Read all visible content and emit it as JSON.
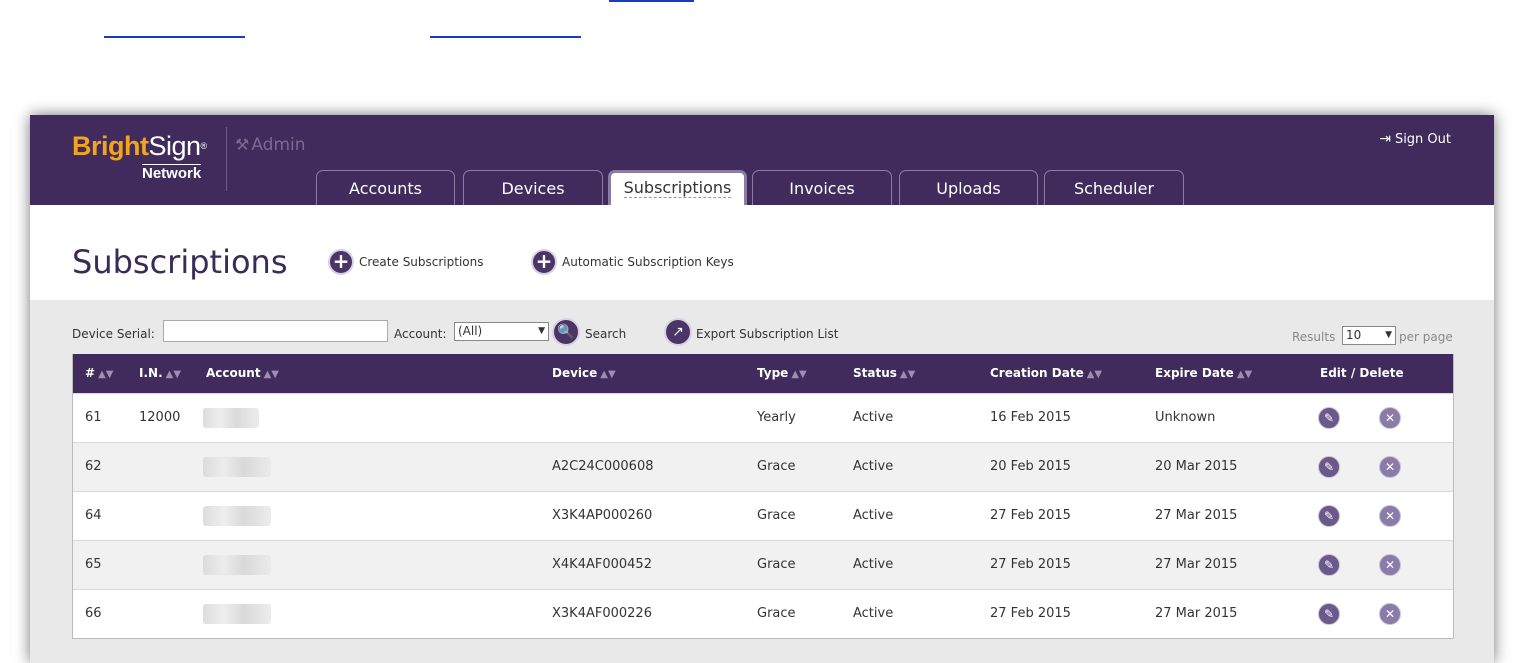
{
  "header": {
    "logo_bright": "Bright",
    "logo_sign": "Sign",
    "logo_sub": "Network",
    "admin_label": "Admin",
    "sign_out_label": "Sign Out"
  },
  "tabs": [
    {
      "label": "Accounts"
    },
    {
      "label": "Devices"
    },
    {
      "label": "Subscriptions",
      "active": true
    },
    {
      "label": "Invoices"
    },
    {
      "label": "Uploads"
    },
    {
      "label": "Scheduler"
    }
  ],
  "page": {
    "title": "Subscriptions",
    "create_label": "Create Subscriptions",
    "auto_keys_label": "Automatic Subscription Keys"
  },
  "filters": {
    "serial_label": "Device Serial:",
    "serial_value": "",
    "account_label": "Account:",
    "account_value": "(All)",
    "search_label": "Search",
    "export_label": "Export Subscription List",
    "results_label": "Results",
    "results_value": "10",
    "per_page_label": "per page"
  },
  "table": {
    "columns": [
      "#",
      "I.N.",
      "Account",
      "Device",
      "Type",
      "Status",
      "Creation Date",
      "Expire Date",
      "Edit / Delete"
    ],
    "rows": [
      {
        "num": "61",
        "in": "12000",
        "device": "",
        "type": "Yearly",
        "status": "Active",
        "created": "16 Feb 2015",
        "expires": "Unknown"
      },
      {
        "num": "62",
        "in": "",
        "device": "A2C24C000608",
        "type": "Grace",
        "status": "Active",
        "created": "20 Feb 2015",
        "expires": "20 Mar 2015"
      },
      {
        "num": "64",
        "in": "",
        "device": "X3K4AP000260",
        "type": "Grace",
        "status": "Active",
        "created": "27 Feb 2015",
        "expires": "27 Mar 2015"
      },
      {
        "num": "65",
        "in": "",
        "device": "X4K4AF000452",
        "type": "Grace",
        "status": "Active",
        "created": "27 Feb 2015",
        "expires": "27 Mar 2015"
      },
      {
        "num": "66",
        "in": "",
        "device": "X3K4AF000226",
        "type": "Grace",
        "status": "Active",
        "created": "27 Feb 2015",
        "expires": "27 Mar 2015"
      }
    ]
  },
  "colors": {
    "brand_purple": "#412a5c",
    "brand_orange": "#f2a41b",
    "link_blue": "#1a39c8"
  }
}
